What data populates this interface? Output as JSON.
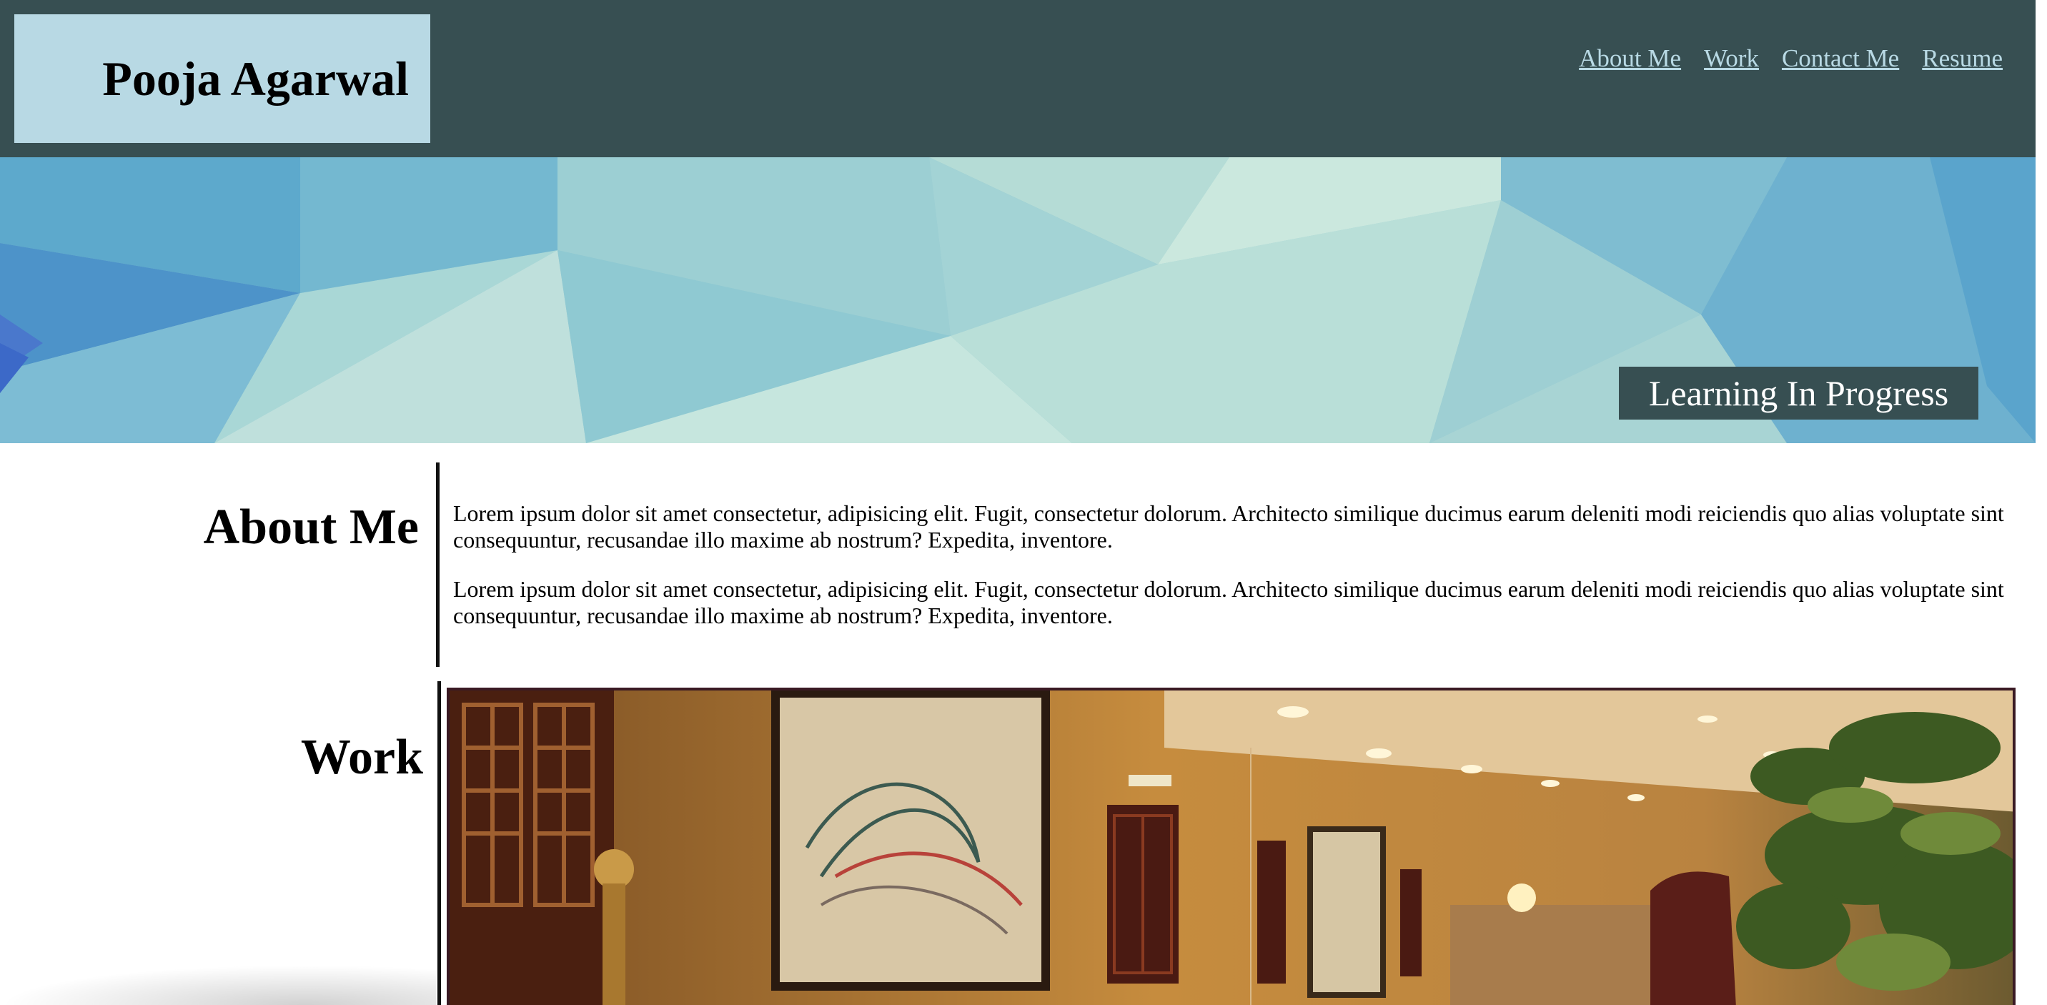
{
  "header": {
    "site_name": "Pooja Agarwal",
    "nav": [
      {
        "label": "About Me"
      },
      {
        "label": "Work"
      },
      {
        "label": "Contact Me"
      },
      {
        "label": "Resume"
      }
    ]
  },
  "hero": {
    "tagline": "Learning In Progress",
    "background": "polygon-pattern-image"
  },
  "about": {
    "heading": "About Me",
    "paragraphs": [
      "Lorem ipsum dolor sit amet consectetur, adipisicing elit. Fugit, consectetur dolorum. Architecto similique ducimus earum deleniti modi reiciendis quo alias voluptate sint consequuntur, recusandae illo maxime ab nostrum? Expedita, inventore.",
      "Lorem ipsum dolor sit amet consectetur, adipisicing elit. Fugit, consectetur dolorum. Architecto similique ducimus earum deleniti modi reiciendis quo alias voluptate sint consequuntur, recusandae illo maxime ab nostrum? Expedita, inventore."
    ]
  },
  "work": {
    "heading": "Work",
    "image": "hotel-lobby-photo"
  },
  "colors": {
    "header_bg": "#374f52",
    "name_box_bg": "#b8d9e4",
    "nav_link": "#b8d9e4",
    "tagline_bg": "#374f52",
    "tagline_text": "#ffffff",
    "work_frame": "#3a1a24"
  }
}
